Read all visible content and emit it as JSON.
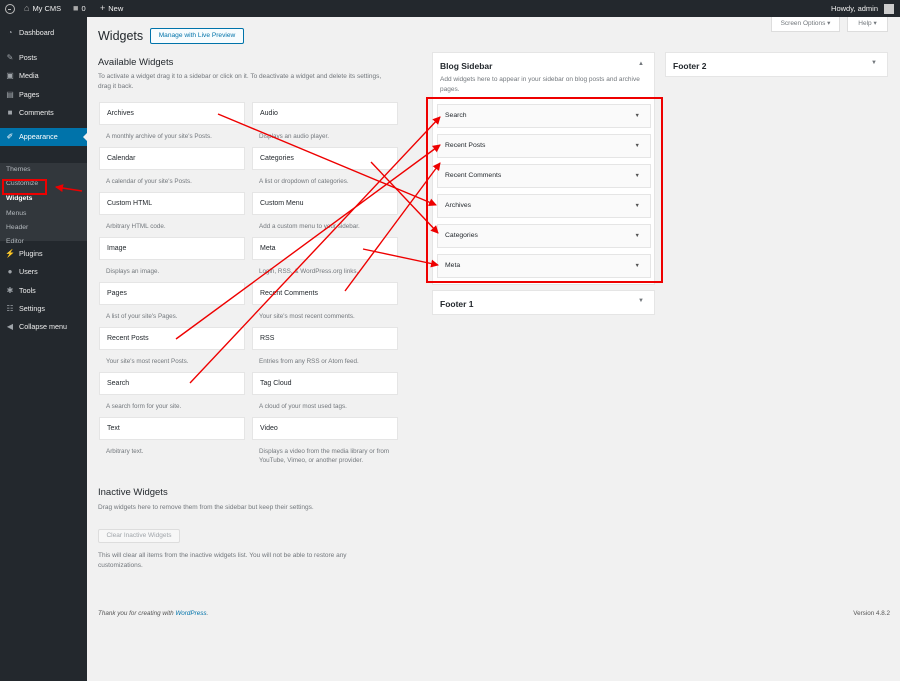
{
  "admin_bar": {
    "site_name": "My CMS",
    "comments_count": "0",
    "new_label": "New",
    "greeting": "Howdy, admin"
  },
  "menu": {
    "dashboard": "Dashboard",
    "posts": "Posts",
    "media": "Media",
    "pages": "Pages",
    "comments": "Comments",
    "appearance": "Appearance",
    "sub": {
      "themes": "Themes",
      "customize": "Customize",
      "widgets": "Widgets",
      "menus": "Menus",
      "header": "Header",
      "editor": "Editor"
    },
    "plugins": "Plugins",
    "users": "Users",
    "tools": "Tools",
    "settings": "Settings",
    "collapse": "Collapse menu"
  },
  "top_buttons": {
    "screen_options": "Screen Options ▾",
    "help": "Help ▾"
  },
  "page": {
    "title": "Widgets",
    "live_preview": "Manage with Live Preview"
  },
  "available": {
    "heading": "Available Widgets",
    "desc": "To activate a widget drag it to a sidebar or click on it. To deactivate a widget and delete its settings, drag it back.",
    "widgets": [
      {
        "name": "Archives",
        "desc": "A monthly archive of your site's Posts."
      },
      {
        "name": "Audio",
        "desc": "Displays an audio player."
      },
      {
        "name": "Calendar",
        "desc": "A calendar of your site's Posts."
      },
      {
        "name": "Categories",
        "desc": "A list or dropdown of categories."
      },
      {
        "name": "Custom HTML",
        "desc": "Arbitrary HTML code."
      },
      {
        "name": "Custom Menu",
        "desc": "Add a custom menu to your sidebar."
      },
      {
        "name": "Image",
        "desc": "Displays an image."
      },
      {
        "name": "Meta",
        "desc": "Login, RSS, & WordPress.org links."
      },
      {
        "name": "Pages",
        "desc": "A list of your site's Pages."
      },
      {
        "name": "Recent Comments",
        "desc": "Your site's most recent comments."
      },
      {
        "name": "Recent Posts",
        "desc": "Your site's most recent Posts."
      },
      {
        "name": "RSS",
        "desc": "Entries from any RSS or Atom feed."
      },
      {
        "name": "Search",
        "desc": "A search form for your site."
      },
      {
        "name": "Tag Cloud",
        "desc": "A cloud of your most used tags."
      },
      {
        "name": "Text",
        "desc": "Arbitrary text."
      },
      {
        "name": "Video",
        "desc": "Displays a video from the media library or from YouTube, Vimeo, or another provider."
      }
    ]
  },
  "inactive": {
    "heading": "Inactive Widgets",
    "desc": "Drag widgets here to remove them from the sidebar but keep their settings.",
    "clear_button": "Clear Inactive Widgets",
    "note": "This will clear all items from the inactive widgets list. You will not be able to restore any customizations."
  },
  "blog_sidebar": {
    "title": "Blog Sidebar",
    "desc": "Add widgets here to appear in your sidebar on blog posts and archive pages.",
    "widgets": [
      "Search",
      "Recent Posts",
      "Recent Comments",
      "Archives",
      "Categories",
      "Meta"
    ]
  },
  "footer1": {
    "title": "Footer 1"
  },
  "footer2": {
    "title": "Footer 2"
  },
  "footer": {
    "thanks_prefix": "Thank you for creating with",
    "thanks_link": "WordPress",
    "thanks_suffix": ".",
    "version": "Version 4.8.2"
  },
  "colors": {
    "annotation": "#e00000",
    "accent": "#0073aa",
    "sidebar_bg": "#23282d"
  }
}
